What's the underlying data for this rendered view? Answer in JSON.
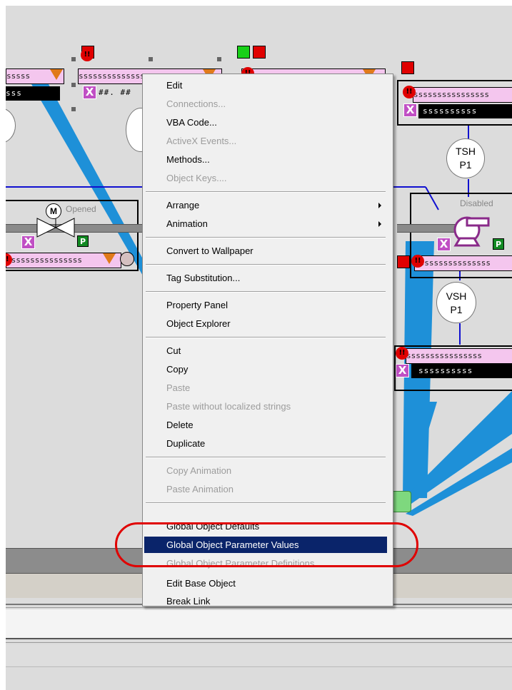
{
  "menu": {
    "items": [
      {
        "label": "Edit",
        "enabled": true
      },
      {
        "label": "Connections...",
        "enabled": false
      },
      {
        "label": "VBA Code...",
        "enabled": true
      },
      {
        "label": "ActiveX Events...",
        "enabled": false
      },
      {
        "label": "Methods...",
        "enabled": true
      },
      {
        "label": "Object Keys....",
        "enabled": false
      },
      {
        "label": "Arrange",
        "enabled": true,
        "submenu": true
      },
      {
        "label": "Animation",
        "enabled": true,
        "submenu": true
      },
      {
        "label": "Convert to Wallpaper",
        "enabled": true
      },
      {
        "label": "Tag Substitution...",
        "enabled": true
      },
      {
        "label": "Property Panel",
        "enabled": true
      },
      {
        "label": "Object Explorer",
        "enabled": true
      },
      {
        "label": "Cut",
        "enabled": true
      },
      {
        "label": "Copy",
        "enabled": true
      },
      {
        "label": "Paste",
        "enabled": false
      },
      {
        "label": "Paste without localized strings",
        "enabled": false
      },
      {
        "label": "Delete",
        "enabled": true
      },
      {
        "label": "Duplicate",
        "enabled": true
      },
      {
        "label": "Copy Animation",
        "enabled": false
      },
      {
        "label": "Paste Animation",
        "enabled": false
      },
      {
        "label": "Global Object Defaults",
        "enabled": true
      },
      {
        "label": "Global Object Parameter Values",
        "enabled": true,
        "highlighted": true
      },
      {
        "label": "Global Object Parameter Definitions",
        "enabled": false
      },
      {
        "label": "Edit Base Object",
        "enabled": true
      },
      {
        "label": "Break Link",
        "enabled": true
      }
    ]
  },
  "canvas": {
    "faceplates": {
      "tag_text": "ssssssssssssssss",
      "tag_short": "sssss",
      "value_short": "sss",
      "value_long": "ssssssssss",
      "value_hash": "##. ##"
    },
    "valve": {
      "motor_label": "M",
      "status": "Opened"
    },
    "pump": {
      "status": "Disabled"
    },
    "tsh": {
      "line1": "TSH",
      "line2": "P1"
    },
    "vsh": {
      "line1": "VSH",
      "line2": "P1"
    },
    "partial_circle_label": "P",
    "badges": {
      "alarm": "!!",
      "x": "X",
      "p": "P"
    }
  },
  "colors": {
    "menu_highlight": "#0a246a",
    "annotation_ring": "#e00000",
    "pipe_blue": "#1e90d8",
    "faceplate_pink": "#f4c6ee"
  }
}
